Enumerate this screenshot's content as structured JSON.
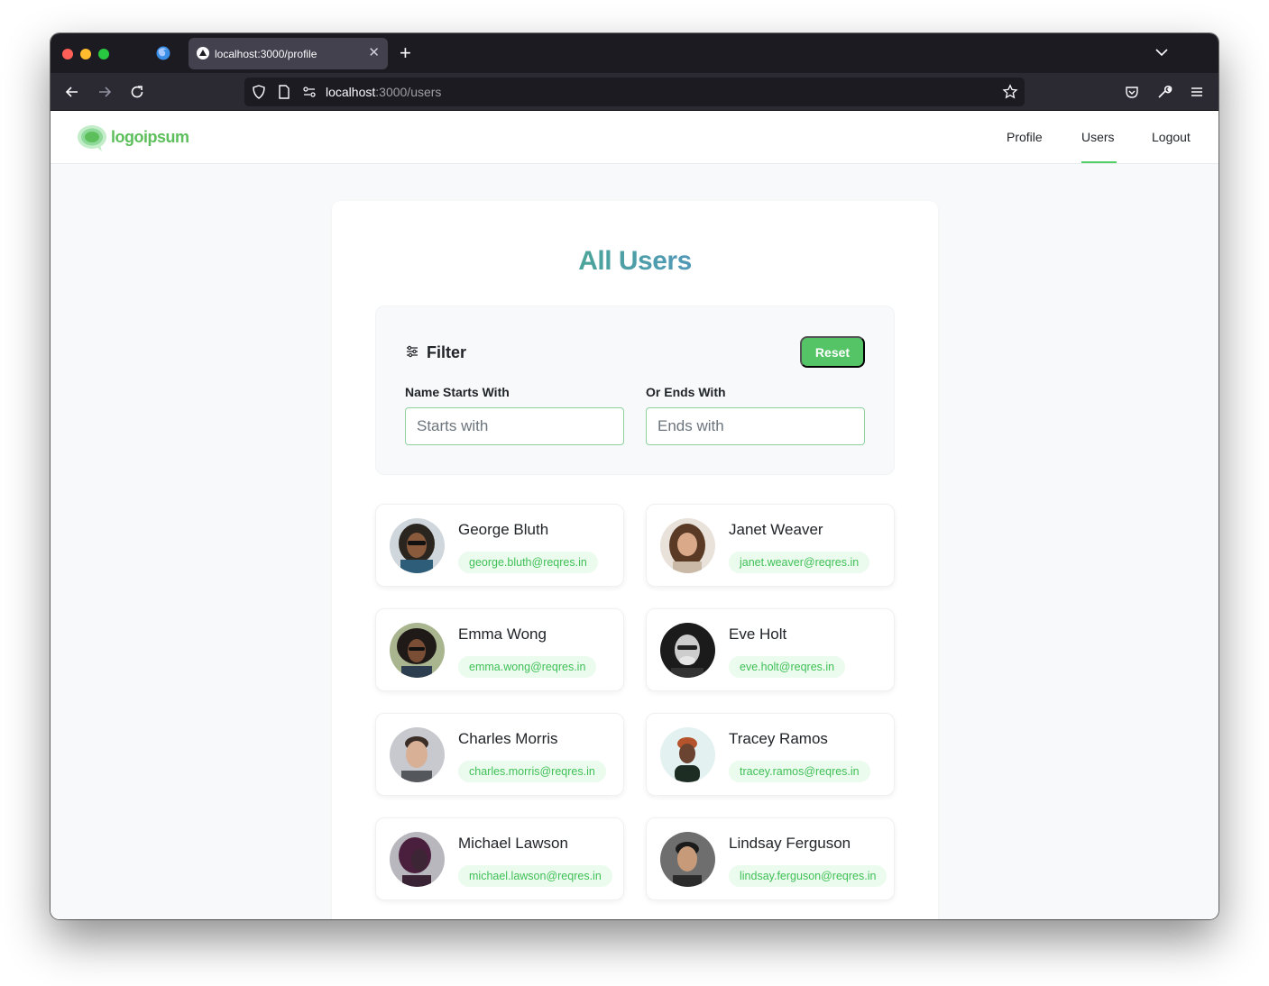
{
  "browser": {
    "tab_title": "localhost:3000/profile",
    "url_host": "localhost",
    "url_path": ":3000/users"
  },
  "header": {
    "logo_text": "logoipsum",
    "nav": [
      {
        "label": "Profile",
        "active": false
      },
      {
        "label": "Users",
        "active": true
      },
      {
        "label": "Logout",
        "active": false
      }
    ],
    "accent_color": "#51cf66"
  },
  "main": {
    "title": "All Users",
    "filter": {
      "title": "Filter",
      "reset_label": "Reset",
      "starts_label": "Name Starts With",
      "starts_placeholder": "Starts with",
      "ends_label": "Or Ends With",
      "ends_placeholder": "Ends with"
    },
    "users": [
      {
        "name": "George Bluth",
        "email": "george.bluth@reqres.in"
      },
      {
        "name": "Janet Weaver",
        "email": "janet.weaver@reqres.in"
      },
      {
        "name": "Emma Wong",
        "email": "emma.wong@reqres.in"
      },
      {
        "name": "Eve Holt",
        "email": "eve.holt@reqres.in"
      },
      {
        "name": "Charles Morris",
        "email": "charles.morris@reqres.in"
      },
      {
        "name": "Tracey Ramos",
        "email": "tracey.ramos@reqres.in"
      },
      {
        "name": "Michael Lawson",
        "email": "michael.lawson@reqres.in"
      },
      {
        "name": "Lindsay Ferguson",
        "email": "lindsay.ferguson@reqres.in"
      }
    ]
  }
}
